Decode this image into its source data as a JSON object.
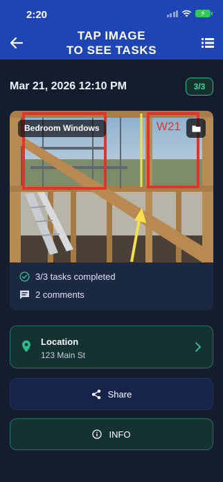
{
  "status_bar": {
    "time": "2:20"
  },
  "header": {
    "title_line1": "TAP IMAGE",
    "title_line2": "TO SEE TASKS"
  },
  "capture": {
    "datetime": "Mar 21, 2026 12:10 PM",
    "task_badge": "3/3"
  },
  "photo": {
    "label": "Bedroom Windows",
    "markup_label": "W21",
    "tasks_text": "3/3 tasks completed",
    "comments_text": "2 comments"
  },
  "location": {
    "title": "Location",
    "address": "123 Main St"
  },
  "actions": {
    "share_label": "Share",
    "info_label": "INFO"
  },
  "colors": {
    "header_bg": "#1f45b4",
    "accent_green": "#2fb98a",
    "page_bg": "#131d2e"
  }
}
